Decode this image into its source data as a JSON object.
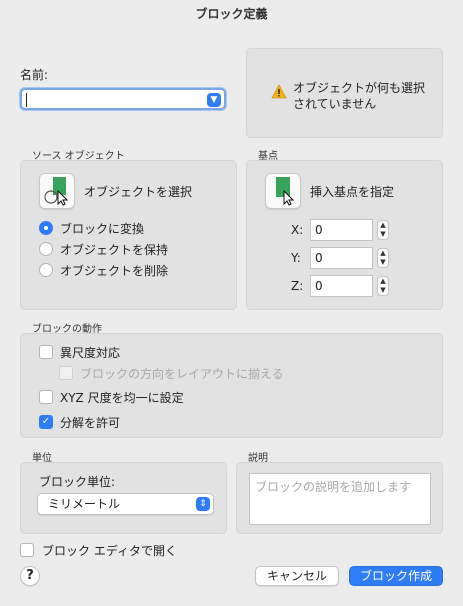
{
  "title": "ブロック定義",
  "name": {
    "label": "名前:",
    "value": ""
  },
  "warning": {
    "icon": "warning-icon",
    "line1": "オブジェクトが何も選択",
    "line2": "されていません"
  },
  "source": {
    "group_label": "ソース オブジェクト",
    "select_button_label": "オブジェクトを選択",
    "options": [
      {
        "label": "ブロックに変換",
        "selected": true
      },
      {
        "label": "オブジェクトを保持",
        "selected": false
      },
      {
        "label": "オブジェクトを削除",
        "selected": false
      }
    ]
  },
  "basepoint": {
    "group_label": "基点",
    "pick_button_label": "挿入基点を指定",
    "x_label": "X:",
    "x_value": "0",
    "y_label": "Y:",
    "y_value": "0",
    "z_label": "Z:",
    "z_value": "0"
  },
  "behavior": {
    "group_label": "ブロックの動作",
    "annotative": {
      "label": "異尺度対応",
      "checked": false
    },
    "match_orientation": {
      "label": "ブロックの方向をレイアウトに揃える",
      "checked": false,
      "disabled": true
    },
    "uniform_scale": {
      "label": "XYZ 尺度を均一に設定",
      "checked": false
    },
    "allow_explode": {
      "label": "分解を許可",
      "checked": true
    }
  },
  "units": {
    "group_label": "単位",
    "label": "ブロック単位:",
    "value": "ミリメートル"
  },
  "description": {
    "group_label": "説明",
    "placeholder": "ブロックの説明を追加します"
  },
  "open_in_editor": {
    "label": "ブロック エディタで開く",
    "checked": false
  },
  "buttons": {
    "help": "?",
    "cancel": "キャンセル",
    "create": "ブロック作成"
  },
  "colors": {
    "accent": "#2e7cf6",
    "block_green": "#3aa35b",
    "warning": "#f2b01e"
  }
}
